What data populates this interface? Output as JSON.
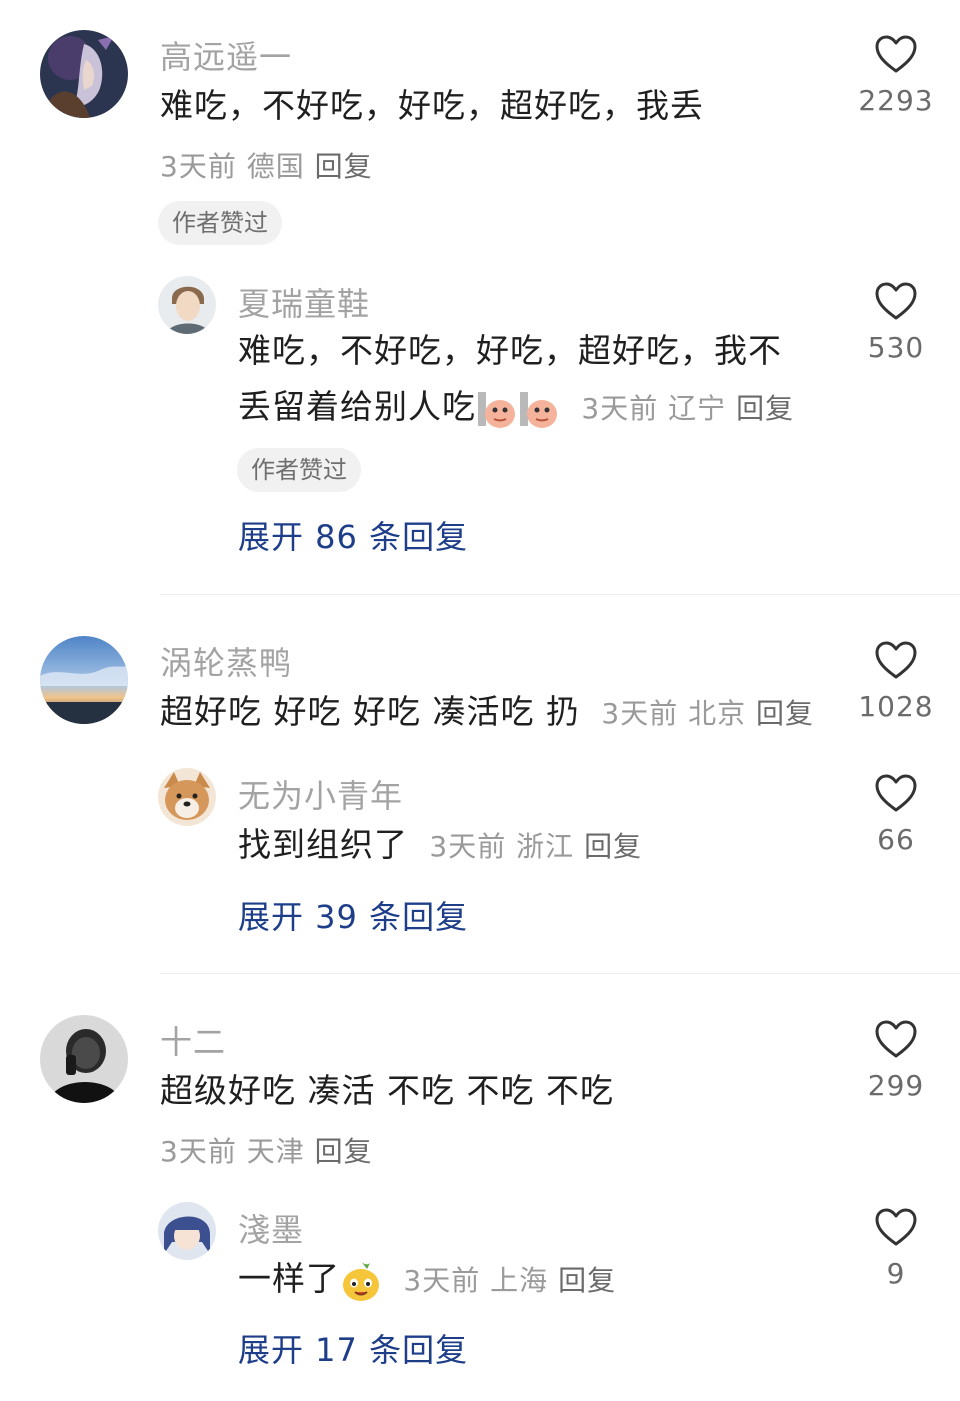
{
  "colors": {
    "link": "#1e3e8a",
    "meta": "#9a9a9a",
    "name": "#a3a3a3",
    "badge_bg": "#f1f1f1"
  },
  "icons": {
    "like": "heart-outline-icon"
  },
  "comments": [
    {
      "user": "高远遥一",
      "text": "难吃，不好吃，好吃，超好吃，我丢",
      "time": "3天前",
      "location": "德国",
      "reply": "回复",
      "badge": "作者赞过",
      "likes": "2293",
      "sub": {
        "user": "夏瑞童鞋",
        "text_line1": "难吃，不好吃，好吃，超好吃，我不",
        "text_line2": "丢留着给别人吃",
        "time": "3天前",
        "location": "辽宁",
        "reply": "回复",
        "badge": "作者赞过",
        "likes": "530"
      },
      "expand": "展开 86 条回复"
    },
    {
      "user": "涡轮蒸鸭",
      "text": "超好吃 好吃 好吃 凑活吃 扔",
      "time": "3天前",
      "location": "北京",
      "reply": "回复",
      "likes": "1028",
      "sub": {
        "user": "无为小青年",
        "text": "找到组织了",
        "time": "3天前",
        "location": "浙江",
        "reply": "回复",
        "likes": "66"
      },
      "expand": "展开 39 条回复"
    },
    {
      "user": "十二",
      "text": "超级好吃 凑活 不吃 不吃 不吃",
      "time": "3天前",
      "location": "天津",
      "reply": "回复",
      "likes": "299",
      "sub": {
        "user": "淺墨",
        "text": "一样了",
        "time": "3天前",
        "location": "上海",
        "reply": "回复",
        "likes": "9"
      },
      "expand": "展开 17 条回复"
    }
  ]
}
